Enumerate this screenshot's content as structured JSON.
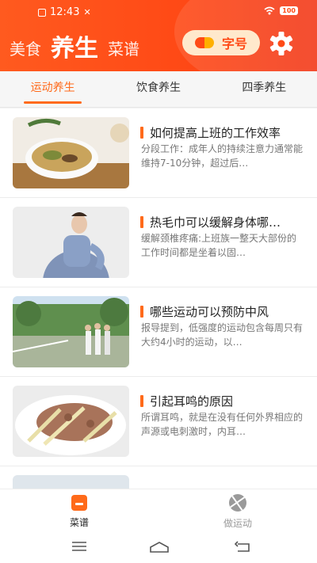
{
  "status_bar": {
    "time": "12:43",
    "battery": "100"
  },
  "top_nav": {
    "tabs": [
      {
        "label": "美食"
      },
      {
        "label": "养生"
      },
      {
        "label": "菜谱"
      }
    ],
    "font_button_label": "字号"
  },
  "category_tabs": [
    {
      "label": "运动养生"
    },
    {
      "label": "饮食养生"
    },
    {
      "label": "四季养生"
    }
  ],
  "articles": [
    {
      "title": "如何提高上班的工作效率",
      "desc": "分段工作：成年人的持续注意力通常能维持7-10分钟，超过后…"
    },
    {
      "title": "热毛巾可以缓解身体哪…",
      "desc": "缓解颈椎疼痛:上班族一整天大部份的工作时间都是坐着以固…"
    },
    {
      "title": "哪些运动可以预防中风",
      "desc": "报导提到，低强度的运动包含每周只有大约4小时的运动，以…"
    },
    {
      "title": "引起耳鸣的原因",
      "desc": "所谓耳鸣，就是在没有任何外界相应的声源或电刺激时，内耳…"
    }
  ],
  "bottom_nav": [
    {
      "label": "菜谱"
    },
    {
      "label": "做运动"
    }
  ],
  "colors": {
    "accent": "#ff6a1a",
    "header": "#ff4a16"
  }
}
